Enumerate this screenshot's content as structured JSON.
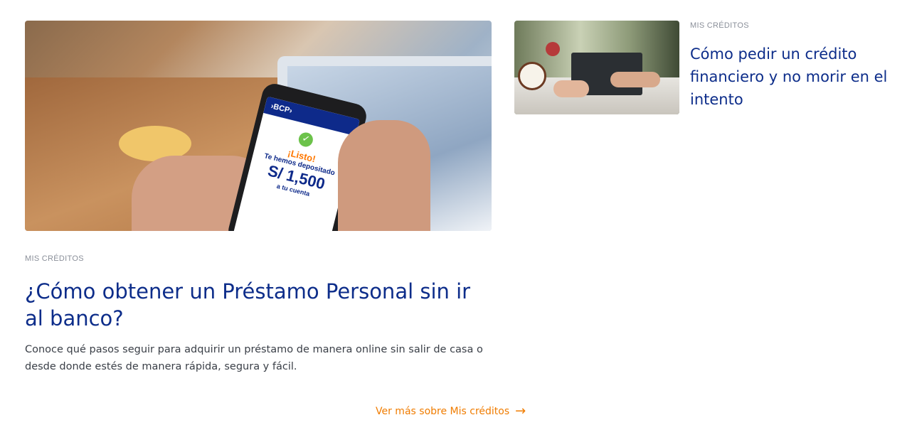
{
  "main_article": {
    "category": "MIS CRÉDITOS",
    "title": "¿Cómo obtener un Préstamo Personal sin ir al banco?",
    "description": "Conoce qué pasos seguir para adquirir un préstamo de manera online sin salir de casa o desde donde estés de manera rápida, segura y fácil.",
    "image": {
      "phone_brand": "›BCP›",
      "phone_status": "¡Listo!",
      "phone_message": "Te hemos depositado",
      "phone_amount": "S/ 1,500",
      "phone_cta": "a tu cuenta"
    }
  },
  "side_article": {
    "category": "MIS CRÉDITOS",
    "title": "Cómo pedir un crédito financiero y no morir en el intento"
  },
  "more_link": {
    "label": "Ver más sobre Mis créditos",
    "icon": "arrow-right-icon"
  },
  "colors": {
    "title": "#0d2d8a",
    "link": "#f07c00",
    "category": "#8a8f99"
  }
}
